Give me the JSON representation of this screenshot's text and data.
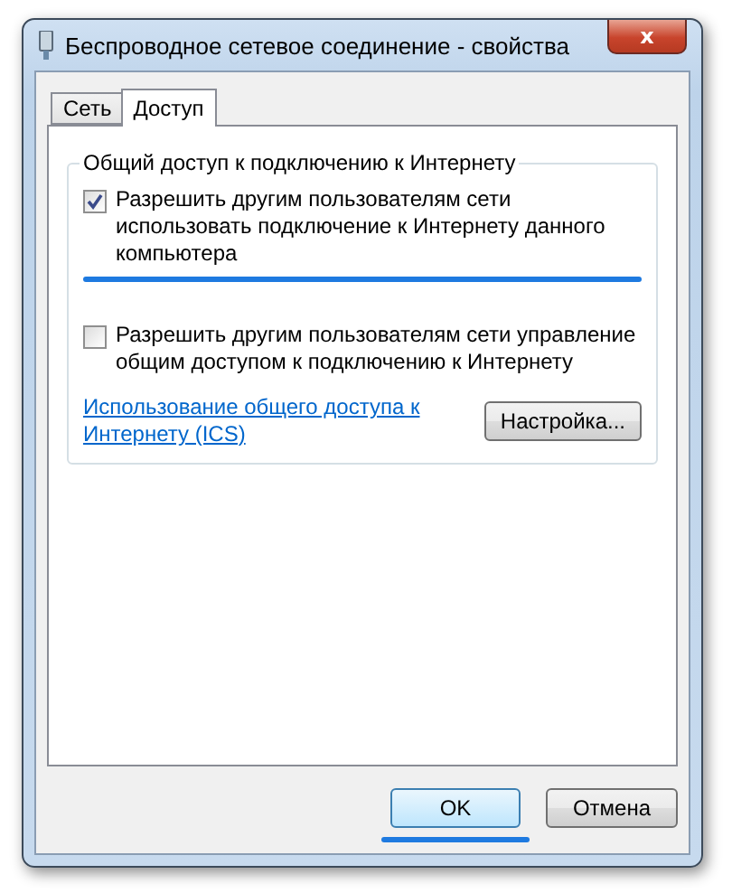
{
  "window": {
    "title": "Беспроводное сетевое соединение - свойства",
    "close": "x"
  },
  "tabs": [
    {
      "label": "Сеть",
      "selected": false
    },
    {
      "label": "Доступ",
      "selected": true
    }
  ],
  "group": {
    "title": "Общий доступ к подключению к Интернету",
    "options": [
      {
        "label": "Разрешить другим пользователям сети использовать подключение к Интернету данного компьютера",
        "checked": true,
        "highlighted": true
      },
      {
        "label": "Разрешить другим пользователям сети управление общим доступом к подключению к Интернету",
        "checked": false,
        "highlighted": false
      }
    ],
    "link": "Использование общего доступа к Интернету (ICS)",
    "settings_button": "Настройка..."
  },
  "buttons": [
    {
      "label": "OK",
      "default": true,
      "highlighted": true
    },
    {
      "label": "Отмена",
      "default": false,
      "highlighted": false
    }
  ]
}
